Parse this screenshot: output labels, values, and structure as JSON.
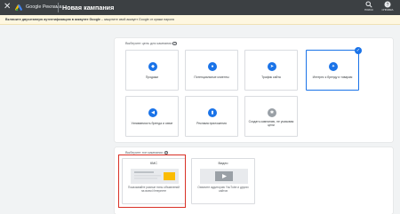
{
  "header": {
    "brand": "Google Реклама",
    "page_title": "Новая кампания",
    "buttons": [
      {
        "icon": "search-icon",
        "label": "ПОИСК"
      },
      {
        "icon": "help-icon",
        "label": "СПРАВКА"
      }
    ]
  },
  "notice": {
    "bold": "Включите двухэтапную аутентификацию в аккаунте Google",
    "rest": " – защитите свой аккаунт Google от кражи пароля"
  },
  "goals": {
    "heading": "Выберите цель для кампании",
    "tiles": [
      {
        "label": "Продажи",
        "icon": "tag-icon",
        "selected": false
      },
      {
        "label": "Потенциальные клиенты",
        "icon": "people-icon",
        "selected": false
      },
      {
        "label": "Трафик сайта",
        "icon": "cursor-icon",
        "selected": false
      },
      {
        "label": "Интерес к бренду и товарам",
        "icon": "sparkle-icon",
        "selected": true
      },
      {
        "label": "Узнаваемость бренда и охват",
        "icon": "megaphone-icon",
        "selected": false
      },
      {
        "label": "Реклама приложения",
        "icon": "phone-icon",
        "selected": false
      },
      {
        "label": "Создать кампанию, не указывая цели",
        "icon": "gear-icon",
        "selected": false
      }
    ]
  },
  "campaign_types": {
    "heading": "Выберите тип кампании",
    "tiles": [
      {
        "title": "КМС",
        "description": "Показывайте разные типы объявлений на всем Интернете"
      },
      {
        "title": "Видео",
        "description": "Охватите аудиторию YouTube и других сайтов"
      }
    ]
  },
  "colors": {
    "topbar": "#3c4043",
    "accent": "#1a73e8",
    "notice_bg": "#fef7e0",
    "highlight": "#d93025"
  }
}
